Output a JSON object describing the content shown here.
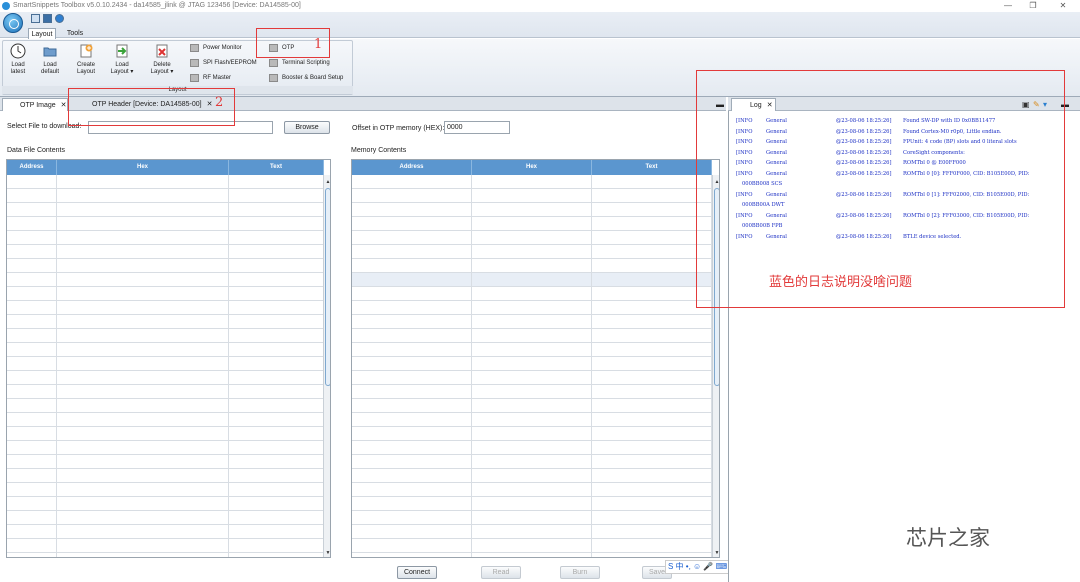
{
  "window": {
    "title": "SmartSnippets Toolbox v5.0.10.2434 - da14585_jlink @ JTAG 123456 [Device: DA14585-00]",
    "controls": [
      "—",
      "❐",
      "✕"
    ]
  },
  "ribbon": {
    "tabs": [
      "Layout",
      "Tools"
    ],
    "group_label": "Layout",
    "big_buttons": [
      {
        "label1": "Load",
        "label2": "latest",
        "icon": "clock-icon"
      },
      {
        "label1": "Load",
        "label2": "default",
        "icon": "folder-icon"
      },
      {
        "label1": "Create",
        "label2": "Layout",
        "icon": "create-layout-icon"
      },
      {
        "label1": "Load",
        "label2": "Layout ▾",
        "icon": "load-layout-icon"
      },
      {
        "label1": "Delete",
        "label2": "Layout ▾",
        "icon": "delete-layout-icon"
      }
    ],
    "small_buttons": [
      "Power Monitor",
      "SPI Flash/EEPROM",
      "RF Master",
      "OTP",
      "Terminal Scripting",
      "Booster & Board Setup"
    ]
  },
  "left_panel": {
    "tabs": [
      "OTP Image",
      "OTP Header [Device: DA14585-00]"
    ],
    "select_file_label": "Select File to download:",
    "select_file_value": "",
    "browse_label": "Browse",
    "offset_label": "Offset in OTP memory (HEX):",
    "offset_value": "0000",
    "data_file_title": "Data File Contents",
    "memory_title": "Memory Contents",
    "columns": [
      "Address",
      "Hex",
      "Text"
    ],
    "buttons": [
      "Connect",
      "Read",
      "Burn",
      "Save"
    ]
  },
  "log_panel": {
    "tab": "Log",
    "entries": [
      {
        "level": "[INFO",
        "source": "General",
        "time": "@23-08-06 18:25:26]",
        "msg": "Found SW-DP with ID 0x0BB11477"
      },
      {
        "level": "[INFO",
        "source": "General",
        "time": "@23-08-06 18:25:26]",
        "msg": "Found Cortex-M0 r0p0, Little endian."
      },
      {
        "level": "[INFO",
        "source": "General",
        "time": "@23-08-06 18:25:26]",
        "msg": "FPUnit: 4 code (BP) slots and 0 literal slots"
      },
      {
        "level": "[INFO",
        "source": "General",
        "time": "@23-08-06 18:25:26]",
        "msg": "CoreSight components:"
      },
      {
        "level": "[INFO",
        "source": "General",
        "time": "@23-08-06 18:25:26]",
        "msg": "ROMTbl 0 @ E00FF000"
      },
      {
        "level": "[INFO",
        "source": "General",
        "time": "@23-08-06 18:25:26]",
        "msg": "ROMTbl 0 [0]: FFF0F000, CID: B105E00D, PID:",
        "cont": "000BB008 SCS"
      },
      {
        "level": "[INFO",
        "source": "General",
        "time": "@23-08-06 18:25:26]",
        "msg": "ROMTbl 0 [1]: FFF02000, CID: B105E00D, PID:",
        "cont": "000BB00A DWT"
      },
      {
        "level": "[INFO",
        "source": "General",
        "time": "@23-08-06 18:25:26]",
        "msg": "ROMTbl 0 [2]: FFF03000, CID: B105E00D, PID:",
        "cont": "000BB00B FPB"
      },
      {
        "level": "[INFO",
        "source": "General",
        "time": "@23-08-06 18:25:26]",
        "msg": "BTLE device selected."
      }
    ]
  },
  "annotations": {
    "num1": "1",
    "num2": "2",
    "note": "蓝色的日志说明没啥问题"
  },
  "watermark": "芯片之家",
  "ime": "S 中 •, ☺ 🎤 ⌨ 👤 👕 ▦",
  "colors": {
    "header_blue": "#5b96cf",
    "log_blue": "#1c2fc4",
    "annotation_red": "#e23a3a"
  }
}
